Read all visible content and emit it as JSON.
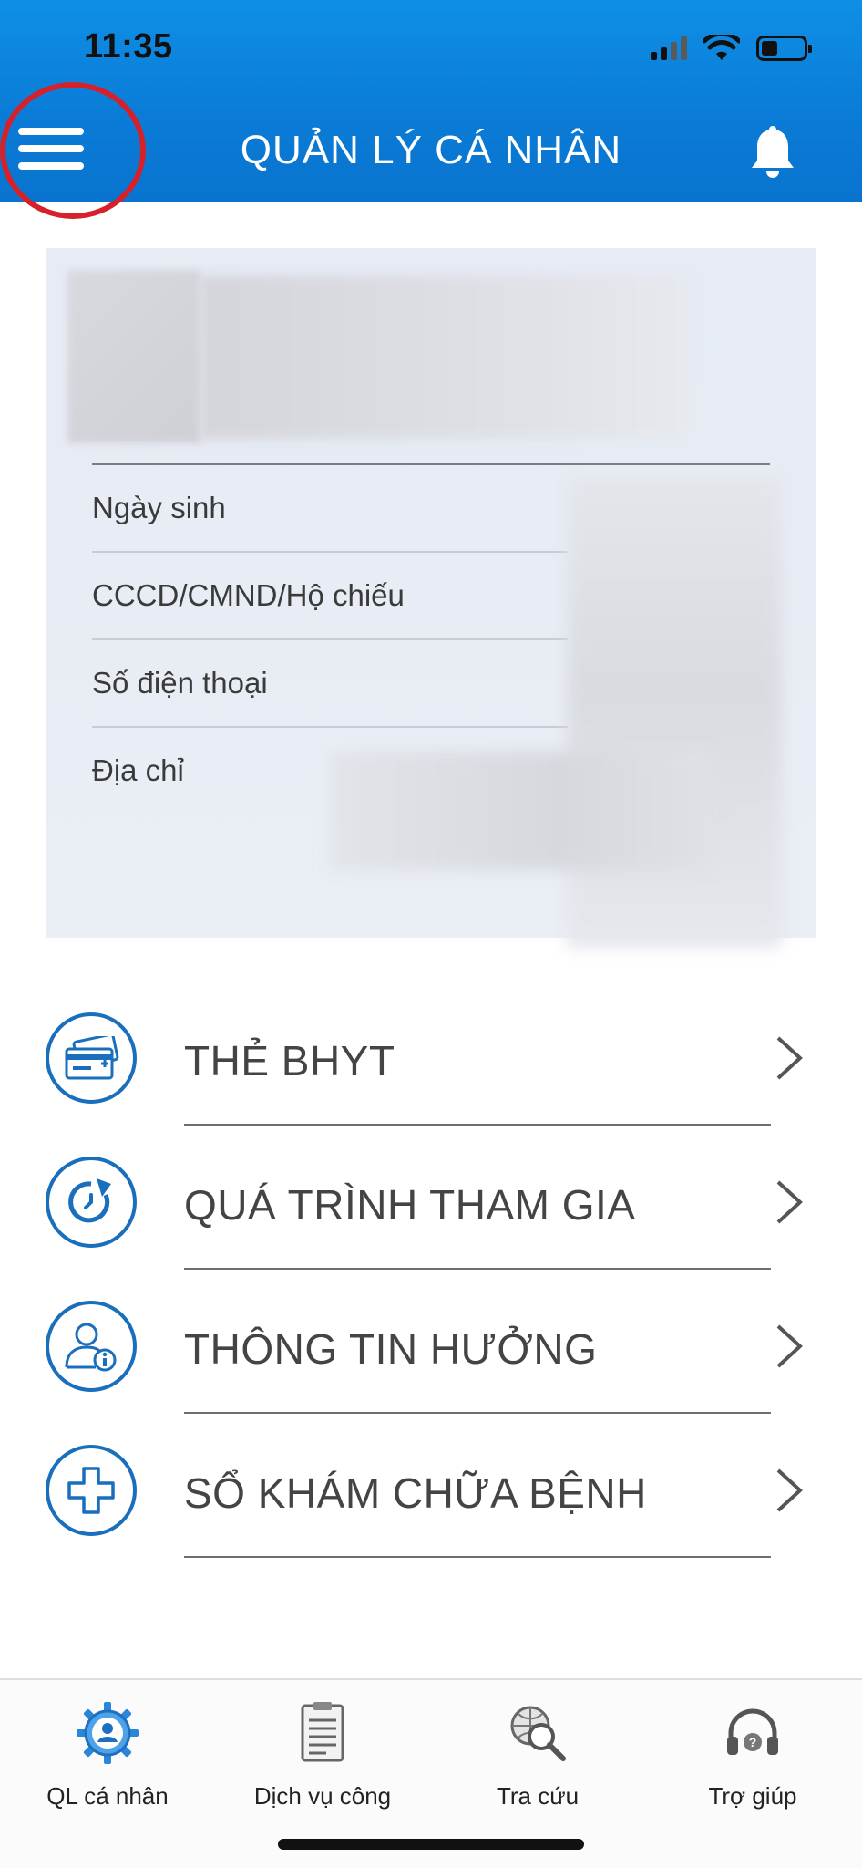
{
  "status_bar": {
    "time": "11:35"
  },
  "header": {
    "title": "QUẢN LÝ CÁ NHÂN"
  },
  "profile": {
    "fields": [
      {
        "label": "Ngày sinh"
      },
      {
        "label": "CCCD/CMND/Hộ chiếu"
      },
      {
        "label": "Số điện thoại"
      },
      {
        "label": "Địa chỉ"
      }
    ]
  },
  "menu": [
    {
      "label": "THẺ BHYT",
      "icon": "health-card-icon"
    },
    {
      "label": "QUÁ TRÌNH THAM GIA",
      "icon": "history-icon"
    },
    {
      "label": "THÔNG TIN HƯỞNG",
      "icon": "user-info-icon"
    },
    {
      "label": "SỔ KHÁM CHỮA BỆNH",
      "icon": "medical-cross-icon"
    }
  ],
  "tabs": [
    {
      "label": "QL cá nhân",
      "icon": "gear-user-icon"
    },
    {
      "label": "Dịch vụ công",
      "icon": "document-icon"
    },
    {
      "label": "Tra cứu",
      "icon": "globe-search-icon"
    },
    {
      "label": "Trợ giúp",
      "icon": "headset-icon"
    }
  ],
  "colors": {
    "header_blue": "#0a7bd6",
    "accent_blue": "#1a6fbd",
    "annotation_red": "#d6212a"
  }
}
